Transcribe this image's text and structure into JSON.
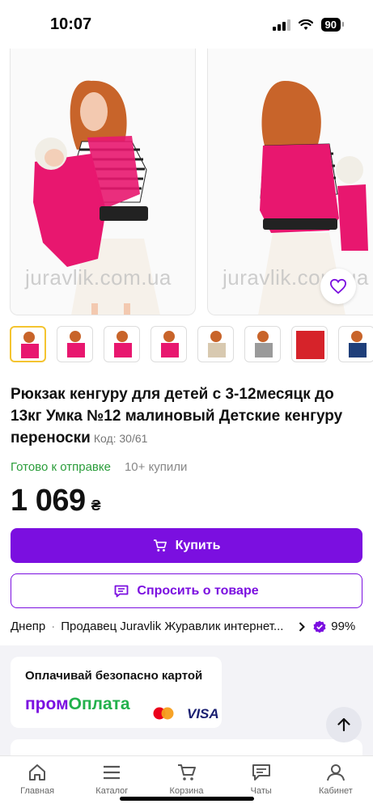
{
  "status_bar": {
    "time": "10:07",
    "battery": "90"
  },
  "gallery": {
    "watermark": "juravlik.com.ua",
    "thumbnail_count": 8
  },
  "product": {
    "title": "Рюкзак кенгуру для детей с 3-12месяцк до 13кг Умка №12 малиновый Детские кенгуру переноски",
    "code": "Код: 30/61",
    "availability": "Готово к отправке",
    "purchases": "10+ купили",
    "price": "1 069",
    "currency": "₴"
  },
  "actions": {
    "buy_label": "Купить",
    "ask_label": "Спросить о товаре"
  },
  "seller": {
    "city": "Днепр",
    "name": "Продавец Juravlik Журавлик интернет...",
    "rating": "99%"
  },
  "payment": {
    "title": "Оплачивай безопасно картой",
    "logo_part1": "пром",
    "logo_part2": "Оплата",
    "visa": "VISA"
  },
  "nav": {
    "items": [
      {
        "label": "Главная",
        "icon": "home-icon"
      },
      {
        "label": "Каталог",
        "icon": "menu-icon"
      },
      {
        "label": "Корзина",
        "icon": "cart-icon"
      },
      {
        "label": "Чаты",
        "icon": "chat-icon"
      },
      {
        "label": "Кабинет",
        "icon": "user-icon"
      }
    ]
  },
  "colors": {
    "accent": "#7b0fe0",
    "ready_green": "#2a9d3a",
    "product_pink": "#e8176f"
  }
}
